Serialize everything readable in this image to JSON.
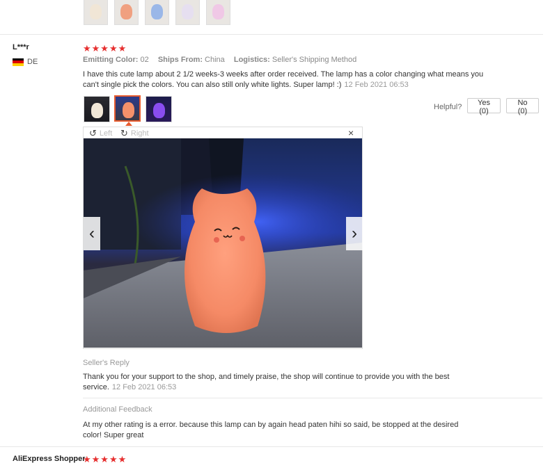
{
  "reviews": [
    {
      "user": "L***r",
      "country": "DE",
      "rating": "★★★★★",
      "meta": {
        "color_label": "Emitting Color:",
        "color_value": "02",
        "ships_label": "Ships From:",
        "ships_value": "China",
        "logistics_label": "Logistics:",
        "logistics_value": "Seller's Shipping Method"
      },
      "text": "I have this cute lamp about 2 1/2 weeks-3 weeks after order received. The lamp has a color changing what means you can't single pick the colors. You can also still only white lights. Super lamp! :)",
      "date": "12 Feb 2021 06:53",
      "helpful": {
        "label": "Helpful?",
        "yes": "Yes (0)",
        "no": "No (0)"
      },
      "viewer": {
        "rotate_left": "Left",
        "rotate_right": "Right",
        "close": "×",
        "prev": "‹",
        "next": "›"
      },
      "seller_reply": {
        "label": "Seller's Reply",
        "text": "Thank you for your support to the shop, and timely praise, the shop will continue to provide you with the best service.",
        "date": "12 Feb 2021 06:53"
      },
      "additional": {
        "label": "Additional Feedback",
        "text": "At my other rating is a error. because this lamp can by again head paten hihi so said, be stopped at the desired color! Super great"
      }
    },
    {
      "user": "AliExpress Shopper",
      "rating": "★★★★★"
    }
  ],
  "colors": {
    "star": "#e62e2e",
    "selected_border": "#e85c2f"
  }
}
